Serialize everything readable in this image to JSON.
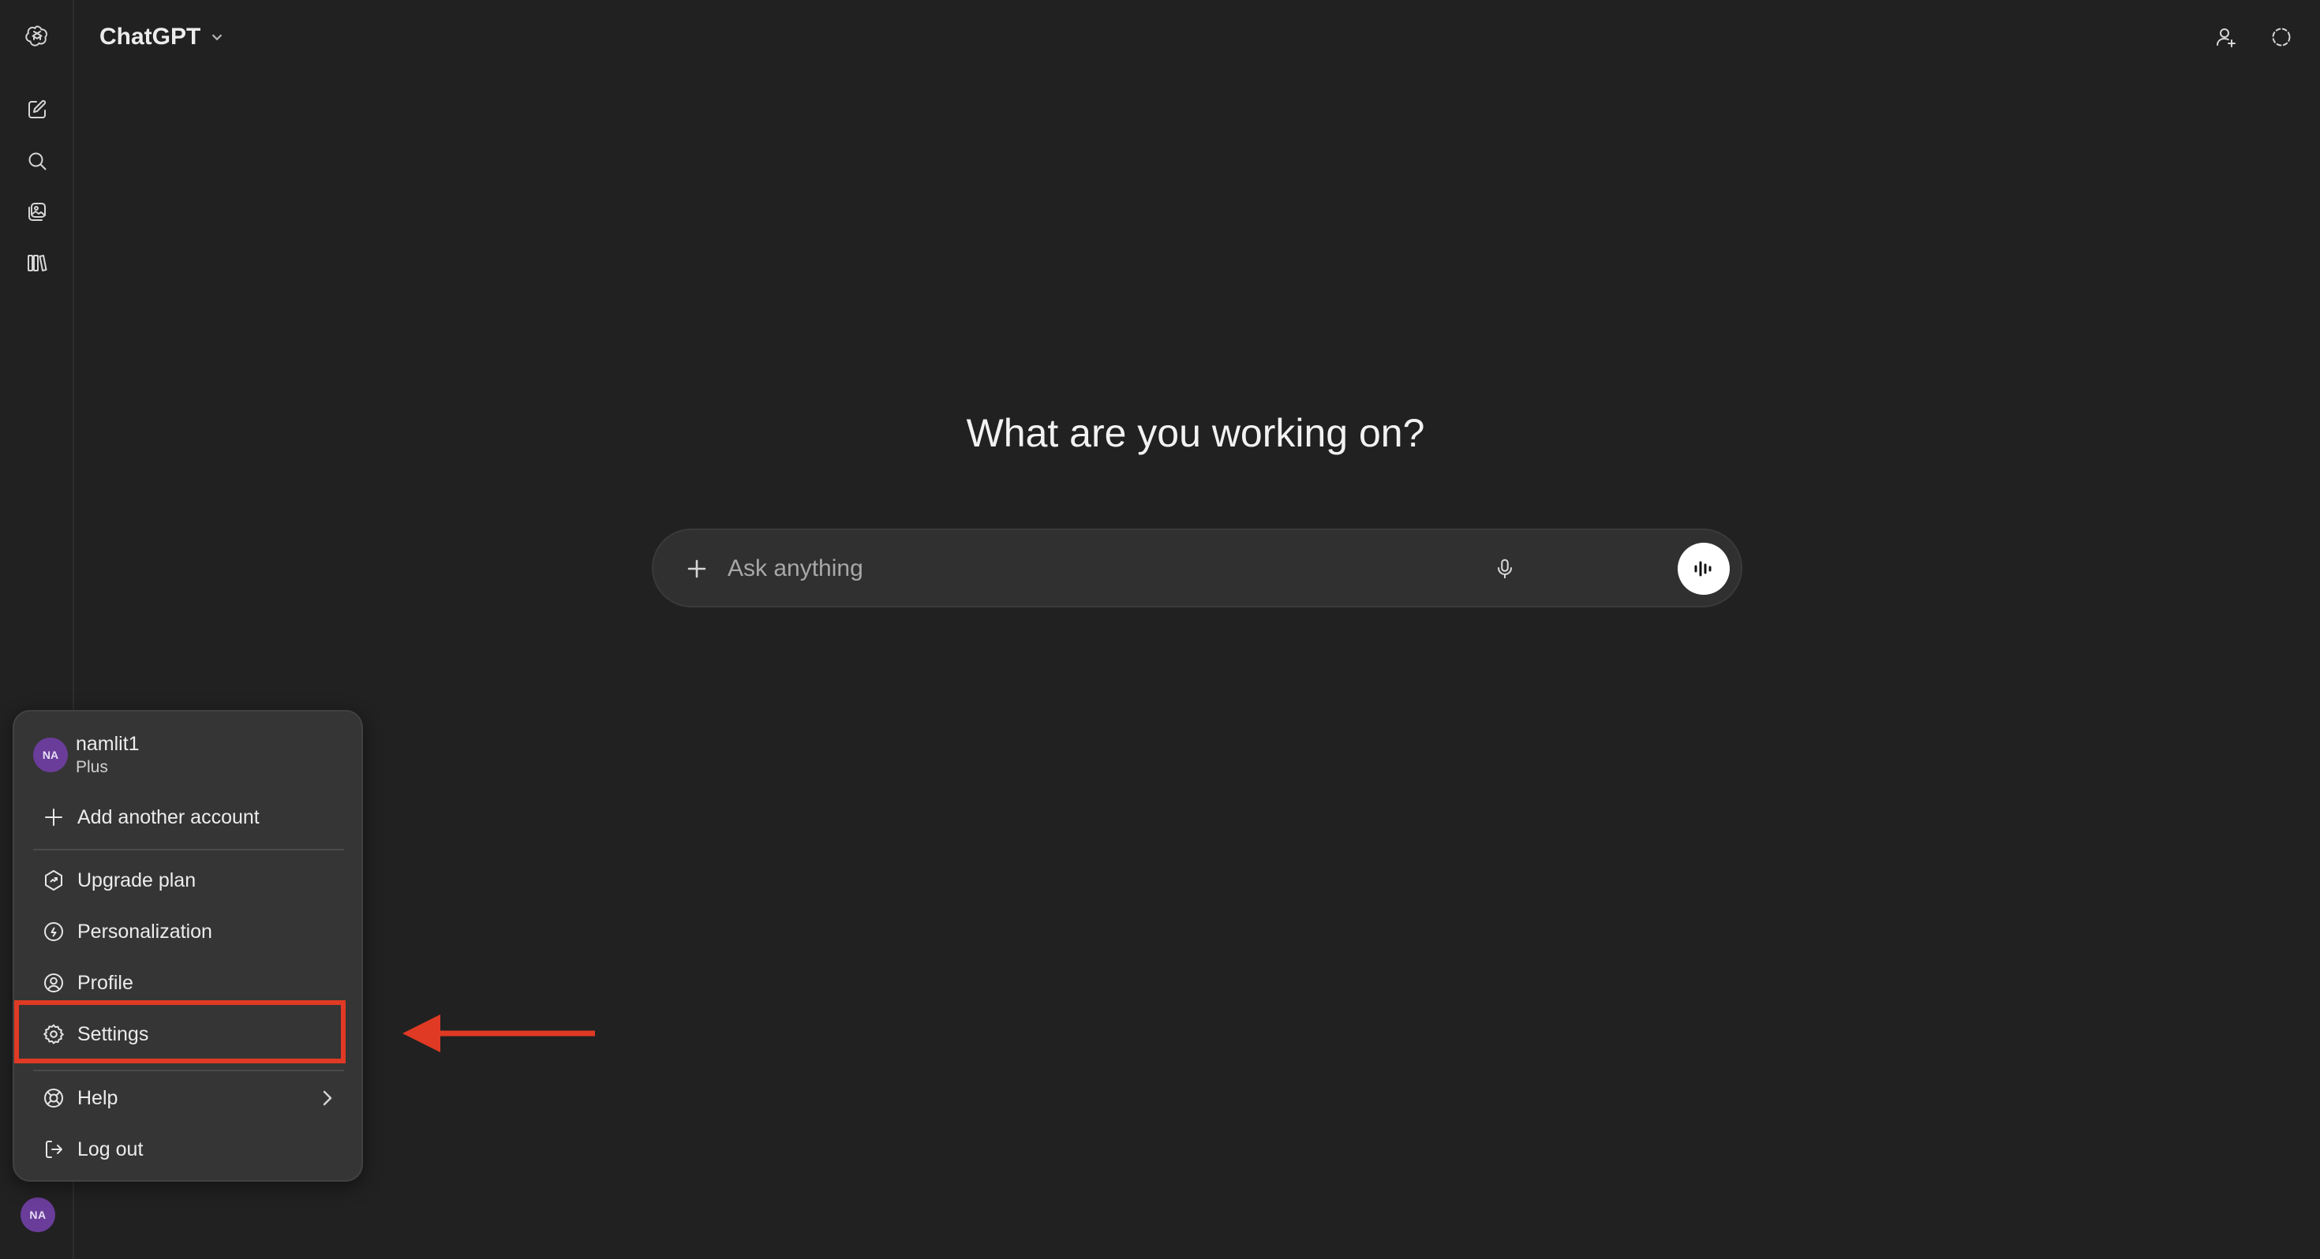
{
  "app": {
    "model_name": "ChatGPT"
  },
  "sidebar": {
    "items": [
      {
        "icon": "openai-logo-icon",
        "label": "ChatGPT home"
      },
      {
        "icon": "new-chat-icon",
        "label": "New chat"
      },
      {
        "icon": "search-icon",
        "label": "Search chats"
      },
      {
        "icon": "images-icon",
        "label": "Images"
      },
      {
        "icon": "library-icon",
        "label": "Library"
      }
    ],
    "avatar_initials": "NA"
  },
  "header": {
    "right_icons": [
      "add-people-icon",
      "temporary-chat-icon"
    ]
  },
  "main": {
    "title": "What are you working on?",
    "composer": {
      "placeholder": "Ask anything"
    }
  },
  "account_menu": {
    "avatar_initials": "NA",
    "username": "namlit1",
    "plan": "Plus",
    "add_account_label": "Add another account",
    "items": [
      {
        "label": "Upgrade plan",
        "icon": "upgrade-icon"
      },
      {
        "label": "Personalization",
        "icon": "personalization-icon"
      },
      {
        "label": "Profile",
        "icon": "profile-icon"
      },
      {
        "label": "Settings",
        "icon": "gear-icon"
      },
      {
        "label": "Help",
        "icon": "help-icon"
      },
      {
        "label": "Log out",
        "icon": "logout-icon"
      }
    ]
  },
  "colors": {
    "background": "#212121",
    "menu_background": "#353535",
    "composer_background": "#303030",
    "avatar": "#6a3d9a",
    "annotation": "#e03a24"
  }
}
